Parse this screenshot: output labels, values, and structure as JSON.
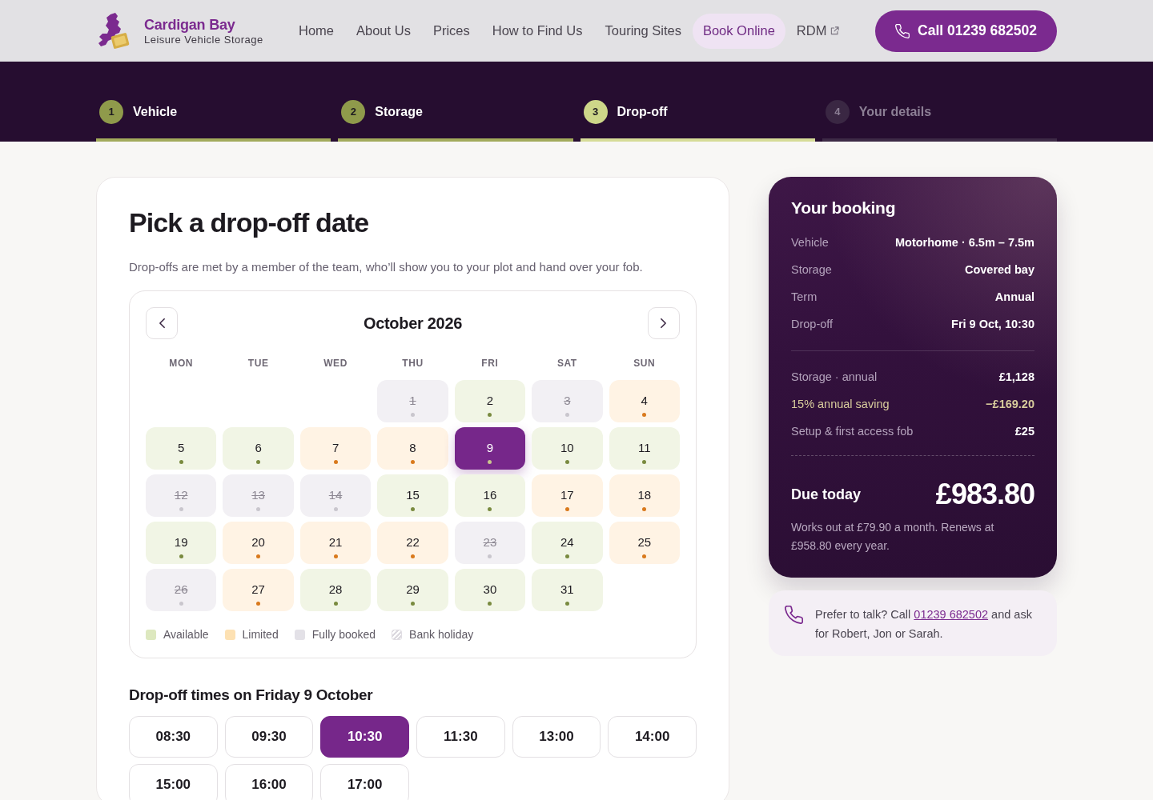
{
  "header": {
    "brand": {
      "name": "Cardigan Bay",
      "tagline": "Leisure Vehicle Storage"
    },
    "nav": [
      {
        "label": "Home",
        "selected": false,
        "external": false
      },
      {
        "label": "About Us",
        "selected": false,
        "external": false
      },
      {
        "label": "Prices",
        "selected": false,
        "external": false
      },
      {
        "label": "How to Find Us",
        "selected": false,
        "external": false
      },
      {
        "label": "Touring Sites",
        "selected": false,
        "external": false
      },
      {
        "label": "Book Online",
        "selected": true,
        "external": false
      },
      {
        "label": "RDM",
        "selected": false,
        "external": true
      }
    ],
    "call_button": "Call 01239 682502"
  },
  "steps": [
    {
      "number": "1",
      "label": "Vehicle",
      "completed": true,
      "selected": false
    },
    {
      "number": "2",
      "label": "Storage",
      "completed": true,
      "selected": false
    },
    {
      "number": "3",
      "label": "Drop-off",
      "completed": false,
      "selected": true
    },
    {
      "number": "4",
      "label": "Your details",
      "completed": false,
      "selected": false
    }
  ],
  "date_picker": {
    "title": "Pick a drop-off date",
    "intro": "Drop-offs are met by a member of the team, who’ll show you to your plot and hand over your fob.",
    "calendar": {
      "month": "October 2026",
      "weekdays": [
        "MON",
        "TUE",
        "WED",
        "THU",
        "FRI",
        "SAT",
        "SUN"
      ],
      "weeks": [
        [
          {
            "day": "1",
            "kind": "booked",
            "selected": false
          },
          {
            "day": "2",
            "kind": "available",
            "selected": false
          },
          {
            "day": "3",
            "kind": "booked",
            "selected": false
          },
          {
            "day": "4",
            "kind": "limited",
            "selected": false
          }
        ],
        [
          {
            "day": "5",
            "kind": "available",
            "selected": false
          },
          {
            "day": "6",
            "kind": "available",
            "selected": false
          },
          {
            "day": "7",
            "kind": "limited",
            "selected": false
          },
          {
            "day": "8",
            "kind": "limited",
            "selected": false
          },
          {
            "day": "9",
            "kind": "available",
            "selected": true
          },
          {
            "day": "10",
            "kind": "available",
            "selected": false
          },
          {
            "day": "11",
            "kind": "available",
            "selected": false
          }
        ],
        [
          {
            "day": "12",
            "kind": "booked",
            "selected": false
          },
          {
            "day": "13",
            "kind": "booked",
            "selected": false
          },
          {
            "day": "14",
            "kind": "booked",
            "selected": false
          },
          {
            "day": "15",
            "kind": "available",
            "selected": false
          },
          {
            "day": "16",
            "kind": "available",
            "selected": false
          },
          {
            "day": "17",
            "kind": "limited",
            "selected": false
          },
          {
            "day": "18",
            "kind": "limited",
            "selected": false
          }
        ],
        [
          {
            "day": "19",
            "kind": "available",
            "selected": false
          },
          {
            "day": "20",
            "kind": "limited",
            "selected": false
          },
          {
            "day": "21",
            "kind": "limited",
            "selected": false
          },
          {
            "day": "22",
            "kind": "limited",
            "selected": false
          },
          {
            "day": "23",
            "kind": "booked",
            "selected": false
          },
          {
            "day": "24",
            "kind": "available",
            "selected": false
          },
          {
            "day": "25",
            "kind": "limited",
            "selected": false
          }
        ],
        [
          {
            "day": "26",
            "kind": "booked",
            "selected": false
          },
          {
            "day": "27",
            "kind": "limited",
            "selected": false
          },
          {
            "day": "28",
            "kind": "available",
            "selected": false
          },
          {
            "day": "29",
            "kind": "available",
            "selected": false
          },
          {
            "day": "30",
            "kind": "available",
            "selected": false
          },
          {
            "day": "31",
            "kind": "available",
            "selected": false
          }
        ]
      ],
      "legend": [
        {
          "kind": "available",
          "label": "Available"
        },
        {
          "kind": "limited",
          "label": "Limited"
        },
        {
          "kind": "booked",
          "label": "Fully booked"
        },
        {
          "kind": "holiday",
          "label": "Bank holiday"
        }
      ]
    },
    "times_title": "Drop-off times on Friday 9 October",
    "times": [
      {
        "time": "08:30",
        "selected": false
      },
      {
        "time": "09:30",
        "selected": false
      },
      {
        "time": "10:30",
        "selected": true
      },
      {
        "time": "11:30",
        "selected": false
      },
      {
        "time": "13:00",
        "selected": false
      },
      {
        "time": "14:00",
        "selected": false
      },
      {
        "time": "15:00",
        "selected": false
      },
      {
        "time": "16:00",
        "selected": false
      },
      {
        "time": "17:00",
        "selected": false
      }
    ]
  },
  "booking": {
    "title": "Your booking",
    "details": [
      {
        "label": "Vehicle",
        "value": "Motorhome · 6.5m – 7.5m"
      },
      {
        "label": "Storage",
        "value": "Covered bay"
      },
      {
        "label": "Term",
        "value": "Annual"
      },
      {
        "label": "Drop-off",
        "value": "Fri 9 Oct, 10:30"
      }
    ],
    "prices": [
      {
        "label": "Storage · annual",
        "value": "£1,128",
        "kind": "charge"
      },
      {
        "label": "15% annual saving",
        "value": "−£169.20",
        "kind": "saving"
      },
      {
        "label": "Setup & first access fob",
        "value": "£25",
        "kind": "charge"
      }
    ],
    "due_label": "Due today",
    "due_value": "£983.80",
    "note": "Works out at £79.90 a month. Renews at £958.80 every year."
  },
  "contact": {
    "text_before": "Prefer to talk? Call ",
    "phone": "01239 682502",
    "text_after": " and ask for Robert, Jon or Sarah."
  }
}
